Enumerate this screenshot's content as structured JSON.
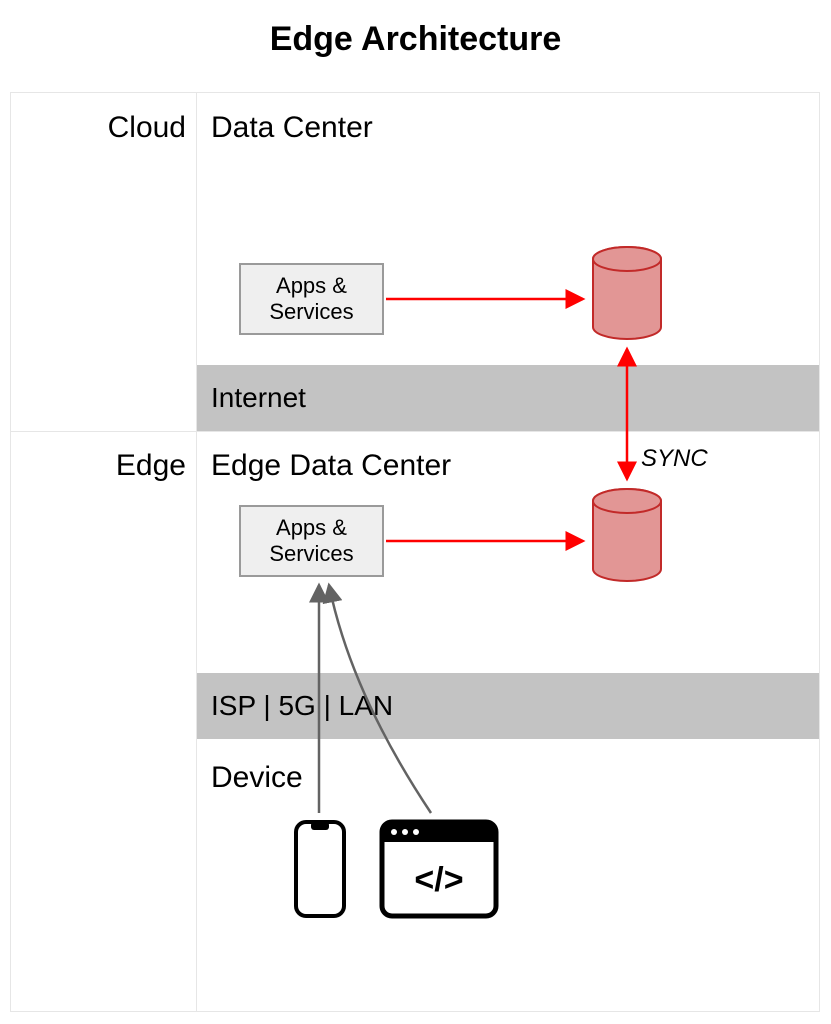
{
  "title": "Edge Architecture",
  "left": {
    "cloud_label": "Cloud",
    "edge_label": "Edge"
  },
  "cloud": {
    "section_label": "Data Center",
    "apps_label": "Apps &\nServices"
  },
  "network": {
    "internet_label": "Internet",
    "isp_label": "ISP | 5G | LAN"
  },
  "edge": {
    "section_label": "Edge Data Center",
    "apps_label": "Apps &\nServices"
  },
  "sync_label": "SYNC",
  "device": {
    "section_label": "Device",
    "code_glyph": "</>"
  },
  "colors": {
    "db_fill": "#e29695",
    "db_stroke": "#c22a29",
    "arrow_red": "#ff0000",
    "arrow_grey": "#636363",
    "box_grey": "#efefef"
  }
}
